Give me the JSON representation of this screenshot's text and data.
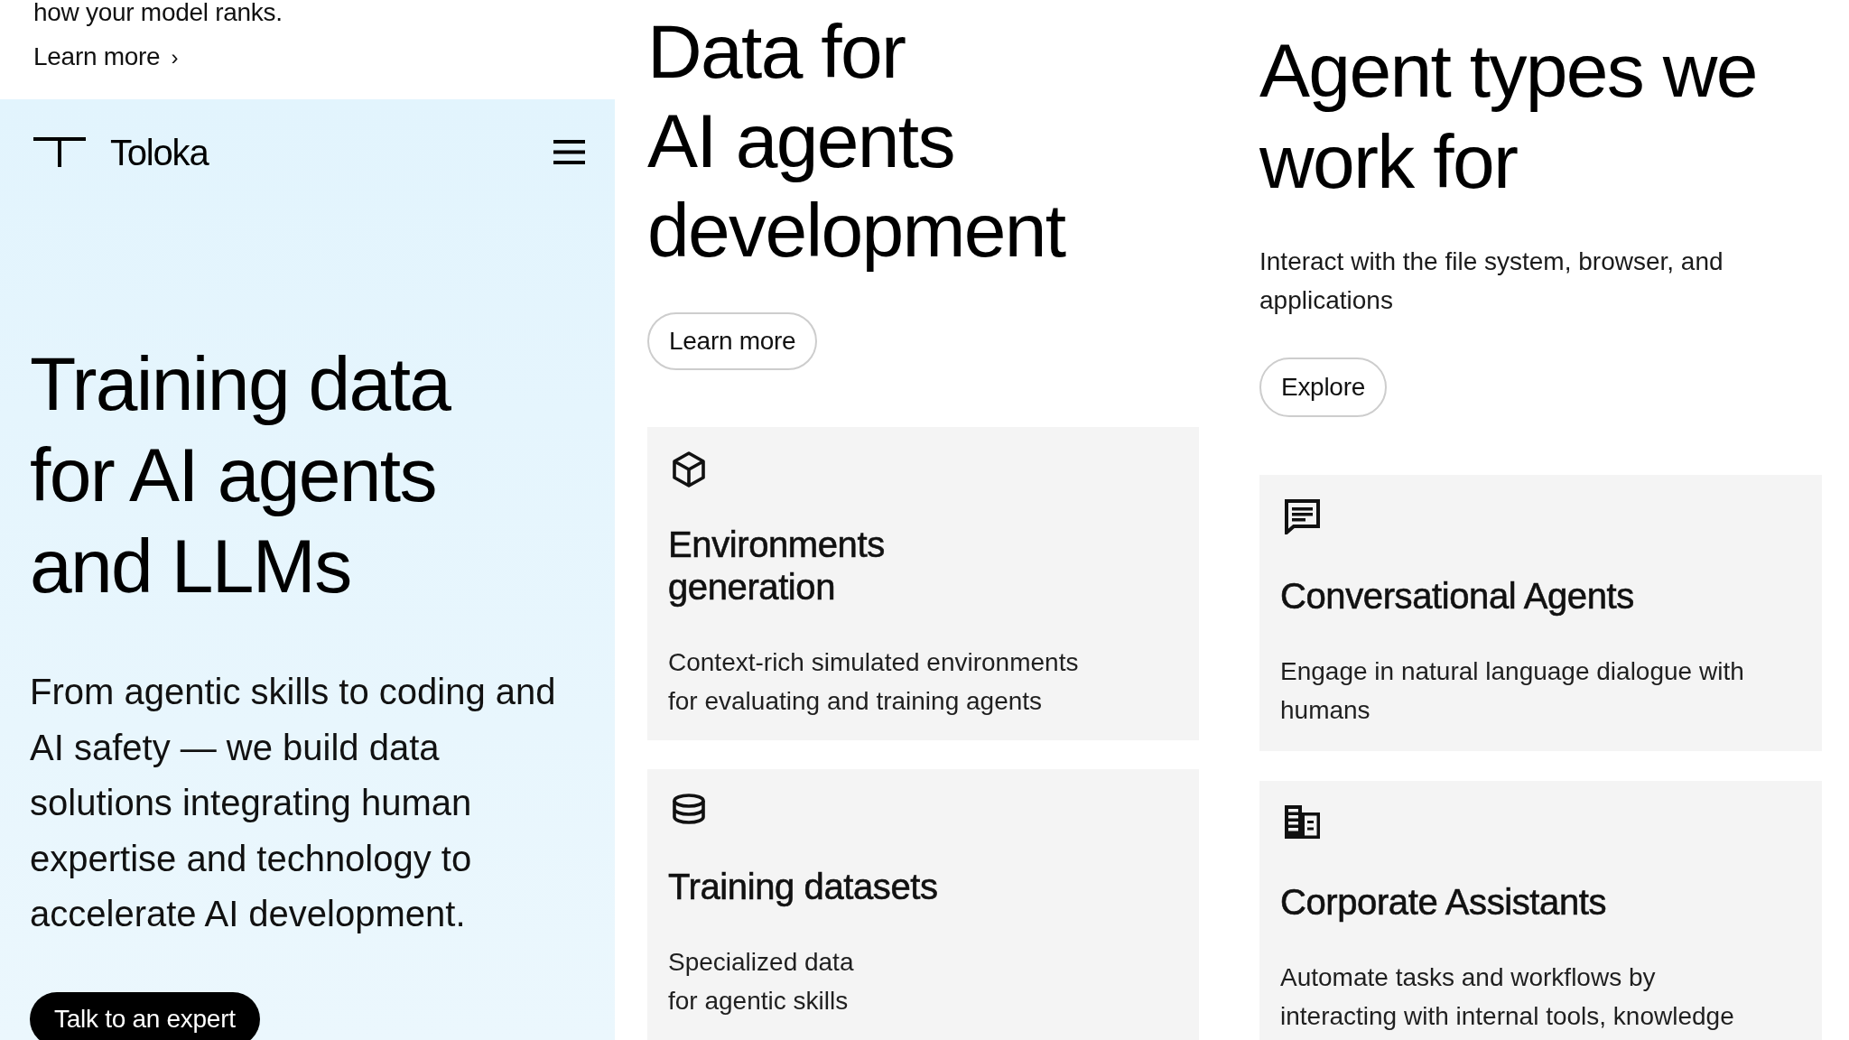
{
  "left_panel": {
    "teaser": {
      "text": "how your model ranks.",
      "link": {
        "label": "Learn more",
        "arrow": "›"
      }
    },
    "header": {
      "brand": "Toloka"
    },
    "hero": {
      "heading": "Training data\nfor AI agents\nand LLMs",
      "description": "From agentic skills to coding and\nAI safety — we build data\nsolutions integrating human\nexpertise and technology to\naccelerate AI development.",
      "button": "Talk to an expert"
    }
  },
  "middle_panel": {
    "heading": "Data for\nAI agents\ndevelopment",
    "button": "Learn more",
    "cards": [
      {
        "title": "Environments\ngeneration",
        "description": "Context-rich simulated environments\nfor evaluating and training agents"
      },
      {
        "title": "Training datasets",
        "description": "Specialized data\nfor agentic skills"
      }
    ]
  },
  "right_panel": {
    "heading": "Agent types we\nwork for",
    "description": "Interact with the file system, browser, and\napplications",
    "button": "Explore",
    "cards": [
      {
        "title": "Conversational Agents",
        "description": "Engage in natural language dialogue with\nhumans"
      },
      {
        "title": "Corporate Assistants",
        "description": "Automate tasks and workflows by\ninteracting with internal tools, knowledge"
      }
    ]
  }
}
